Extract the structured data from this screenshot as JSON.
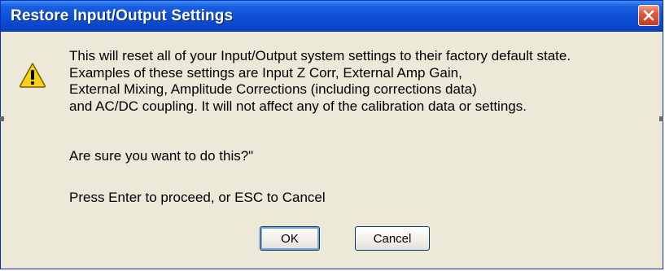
{
  "dialog": {
    "title": "Restore Input/Output Settings",
    "close_icon": "close-icon",
    "warning_icon": "warning-icon",
    "message_lines": [
      "This will reset all of your Input/Output system settings to their factory default state.",
      "Examples of these settings are Input Z Corr, External Amp Gain,",
      "External Mixing, Amplitude Corrections (including corrections data)",
      "and AC/DC coupling.  It will not affect any of the calibration data or settings."
    ],
    "question": "Are sure you want to do this?\"",
    "hint": "Press Enter to proceed, or ESC to Cancel",
    "ok_label": "OK",
    "cancel_label": "Cancel"
  },
  "colors": {
    "titlebar": "#0d4fd6",
    "dialog_background": "#ece9d8",
    "close_button": "#e0593a",
    "warning_yellow": "#f7d21a"
  }
}
